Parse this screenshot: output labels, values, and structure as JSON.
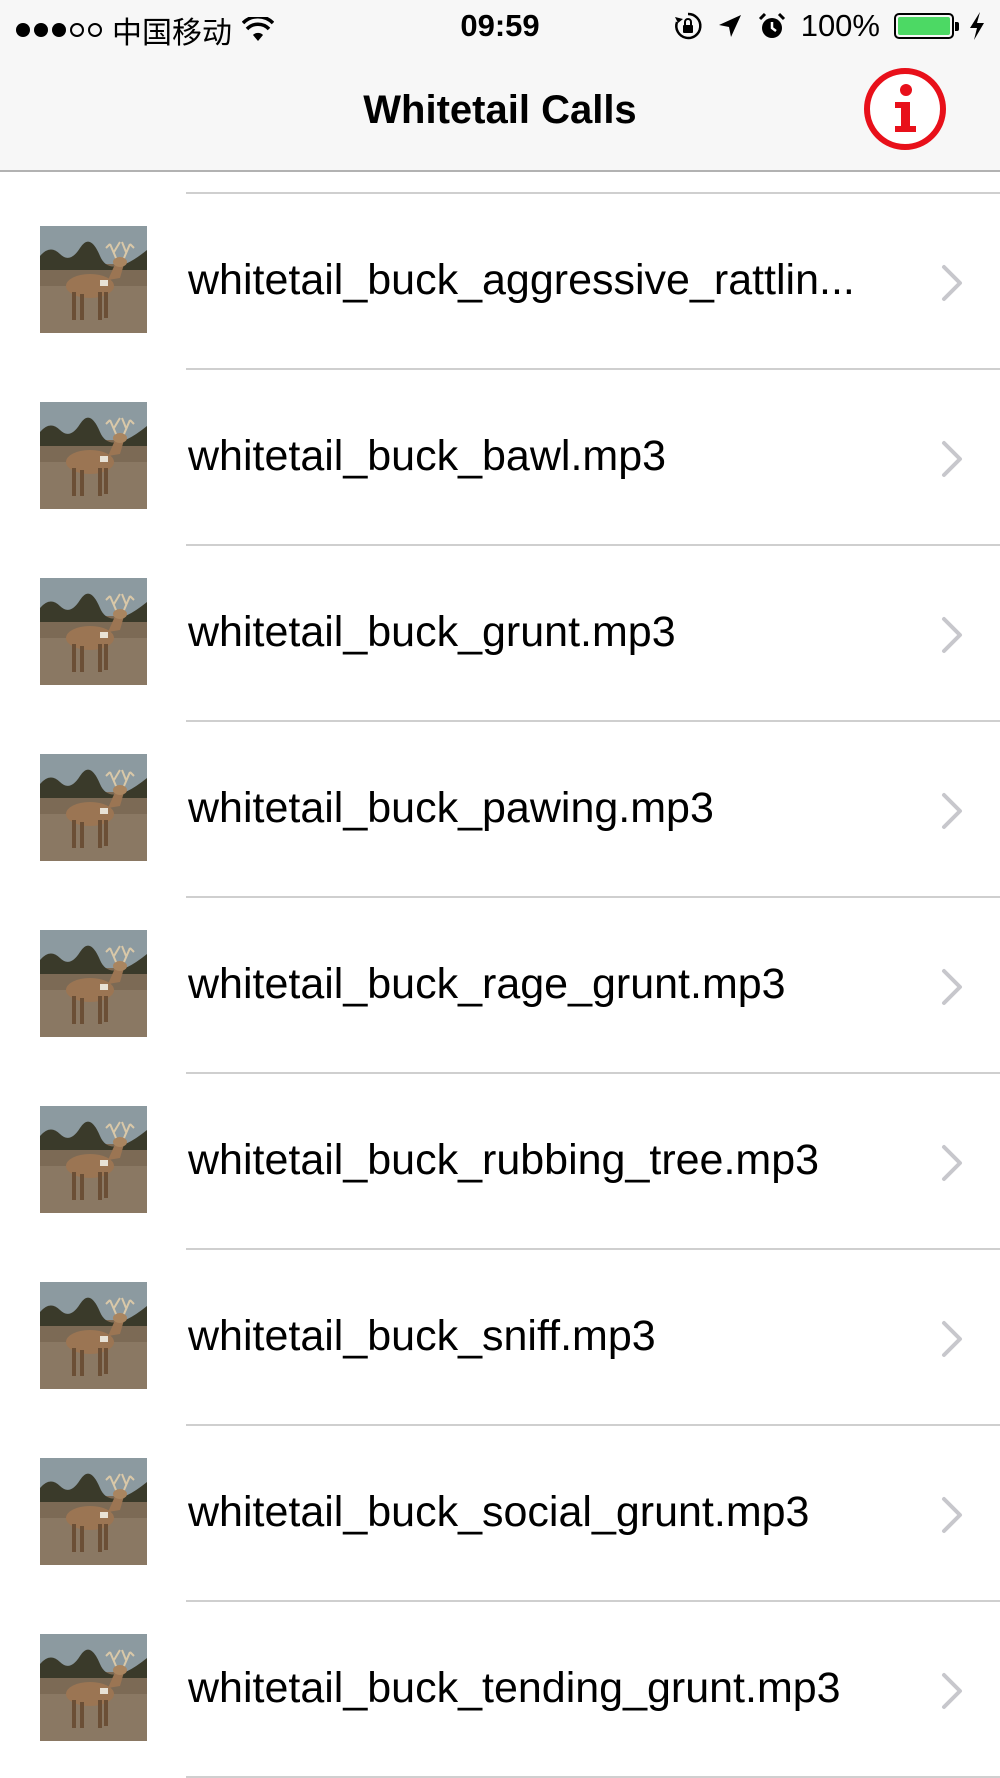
{
  "status_bar": {
    "carrier": "中国移动",
    "time": "09:59",
    "battery_percent": "100%",
    "battery_level": 1.0,
    "icons": [
      "signal-dots-icon",
      "wifi-icon",
      "orientation-lock-icon",
      "location-arrow-icon",
      "alarm-clock-icon",
      "battery-icon",
      "charging-bolt-icon"
    ]
  },
  "nav": {
    "title": "Whitetail Calls",
    "info_icon": "info-icon",
    "info_color": "#e8101a"
  },
  "list": {
    "thumbnail_icon": "whitetail-deer-thumbnail",
    "chevron_icon": "chevron-right-icon",
    "items": [
      {
        "label": "whitetail_buck_aggressive_rattlin..."
      },
      {
        "label": "whitetail_buck_bawl.mp3"
      },
      {
        "label": "whitetail_buck_grunt.mp3"
      },
      {
        "label": "whitetail_buck_pawing.mp3"
      },
      {
        "label": "whitetail_buck_rage_grunt.mp3"
      },
      {
        "label": "whitetail_buck_rubbing_tree.mp3"
      },
      {
        "label": "whitetail_buck_sniff.mp3"
      },
      {
        "label": "whitetail_buck_social_grunt.mp3"
      },
      {
        "label": "whitetail_buck_tending_grunt.mp3"
      }
    ]
  }
}
